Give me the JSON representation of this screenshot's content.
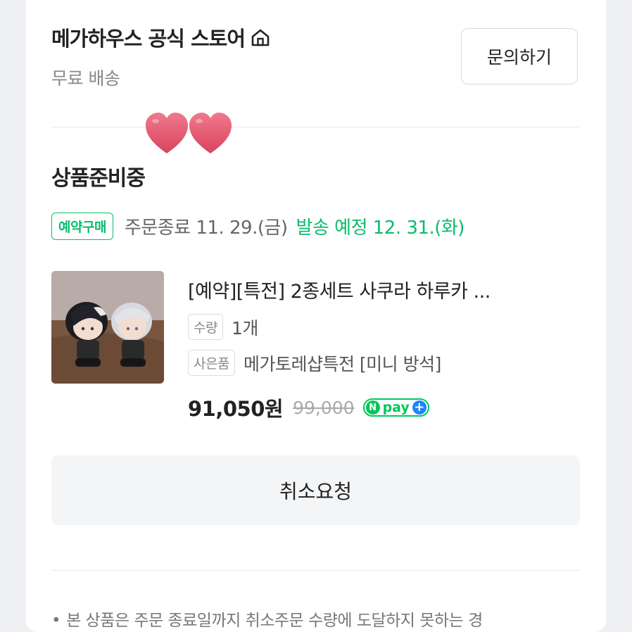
{
  "store": {
    "name": "메가하우스 공식 스토어",
    "icon": "store-home-icon",
    "shipping": "무료 배송",
    "inquiry_label": "문의하기"
  },
  "order": {
    "status": "상품준비중",
    "badge": "예약구매",
    "order_end": "주문종료 11. 29.(금)",
    "ship_date": "발송 예정 12. 31.(화)"
  },
  "product": {
    "title": "[예약][특전] 2종세트 사쿠라 하루카 ...",
    "qty_label": "수량",
    "qty_value": "1개",
    "gift_label": "사은품",
    "gift_value": "메가토레샵특전 [미니 방석]",
    "price": "91,050원",
    "original_price": "99,000",
    "npay_n": "N",
    "npay_text": "pay",
    "npay_plus": "+"
  },
  "cancel_label": "취소요청",
  "notice": {
    "bullet": "•",
    "text": "본 상품은 주문 종료일까지 취소주문 수량에 도달하지 못하는 경"
  },
  "colors": {
    "accent_green": "#0dbb6b",
    "npay_green": "#03c75a",
    "npay_blue": "#1a86ff",
    "heart": "#e8506a"
  }
}
